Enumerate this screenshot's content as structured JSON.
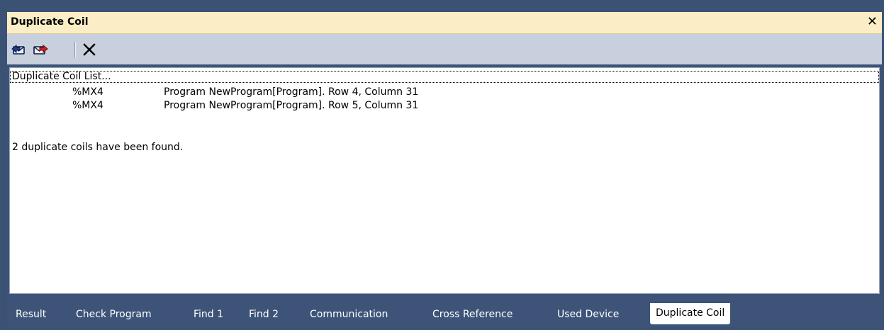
{
  "window": {
    "title": "Duplicate Coil",
    "close_label": "✕"
  },
  "toolbar": {
    "buttons": [
      {
        "name": "previous-item-icon"
      },
      {
        "name": "next-item-icon"
      },
      {
        "name": "clear-icon"
      }
    ]
  },
  "list": {
    "header": "Duplicate Coil List...",
    "rows": [
      {
        "address": "%MX4",
        "location": "Program NewProgram[Program]. Row 4, Column 31"
      },
      {
        "address": "%MX4",
        "location": "Program NewProgram[Program]. Row 5, Column 31"
      }
    ],
    "summary": "2 duplicate coils have been found."
  },
  "tabs": [
    {
      "label": "Result"
    },
    {
      "label": "Check Program"
    },
    {
      "label": "Find 1"
    },
    {
      "label": "Find 2"
    },
    {
      "label": "Communication"
    },
    {
      "label": "Cross Reference"
    },
    {
      "label": "Used Device"
    },
    {
      "label": "Duplicate Coil",
      "active": true
    }
  ],
  "colors": {
    "title_bg": "#fbeec6",
    "toolbar_bg": "#c8d0de",
    "frame_bg": "#3d5478"
  }
}
